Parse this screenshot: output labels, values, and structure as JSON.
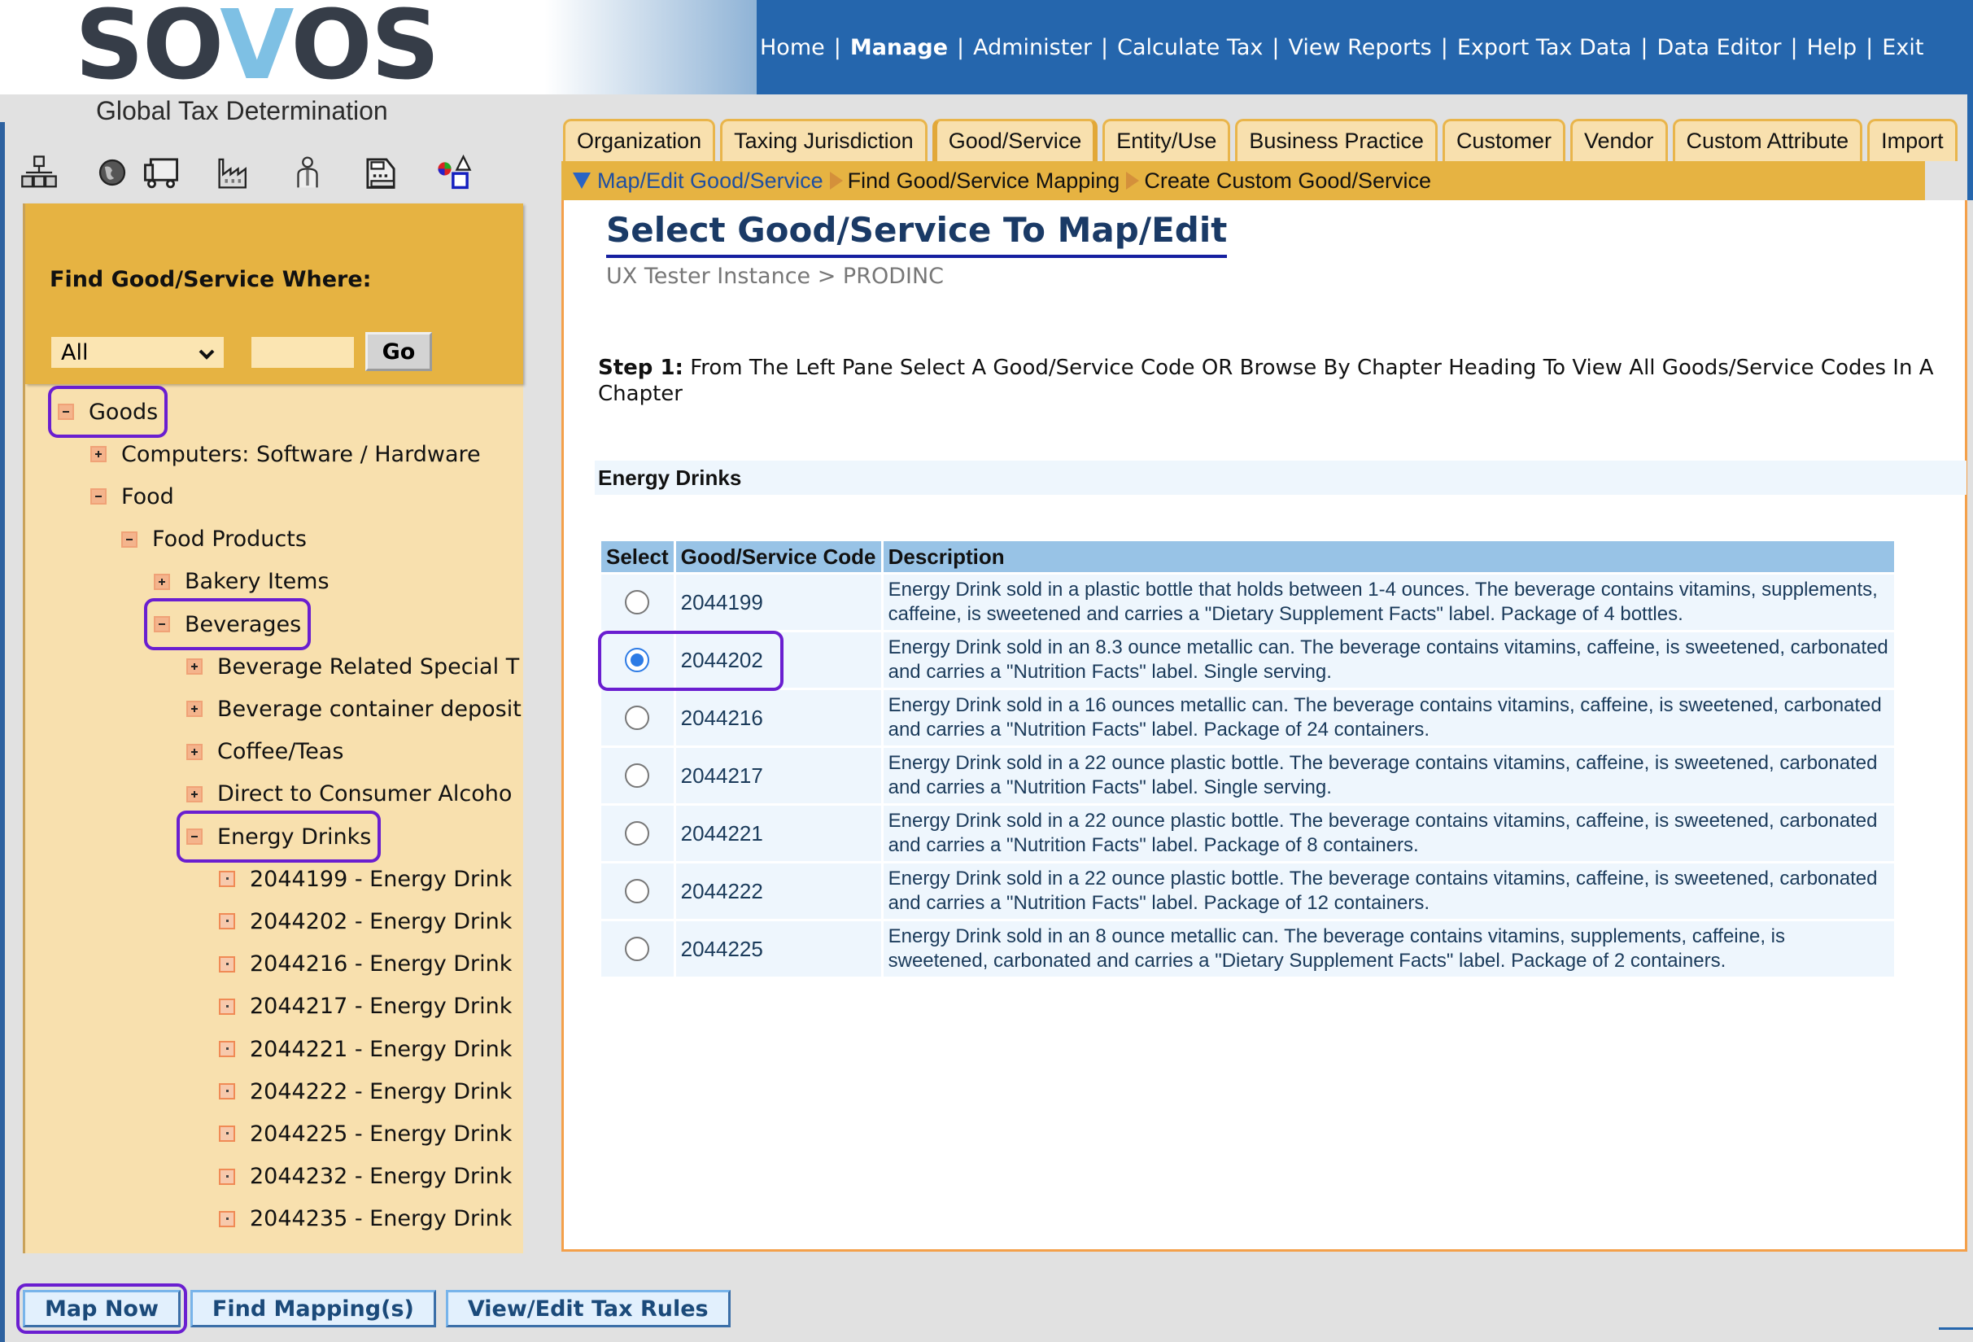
{
  "brand": {
    "logo_prefix": "SO",
    "logo_v": "V",
    "logo_suffix": "OS",
    "subtitle": "Global Tax Determination"
  },
  "top_nav": {
    "items": [
      {
        "label": "Home",
        "active": false
      },
      {
        "label": "Manage",
        "active": true
      },
      {
        "label": "Administer",
        "active": false
      },
      {
        "label": "Calculate Tax",
        "active": false
      },
      {
        "label": "View Reports",
        "active": false
      },
      {
        "label": "Export Tax Data",
        "active": false
      },
      {
        "label": "Data Editor",
        "active": false
      },
      {
        "label": "Help",
        "active": false
      },
      {
        "label": "Exit",
        "active": false
      }
    ],
    "separator": "|"
  },
  "toolbar_icons": [
    "organization-hierarchy-icon",
    "globe-icon",
    "truck-icon",
    "factory-icon",
    "person-icon",
    "cash-register-icon",
    "shapes-icon"
  ],
  "search": {
    "label": "Find Good/Service Where:",
    "select_value": "All",
    "input_value": "",
    "go_label": "Go"
  },
  "tree": {
    "nodes": [
      {
        "label": "Goods",
        "toggle": "minus",
        "level": 0,
        "highlighted": true
      },
      {
        "label": "Computers: Software / Hardware",
        "toggle": "plus",
        "level": 1
      },
      {
        "label": "Food",
        "toggle": "minus",
        "level": 1
      },
      {
        "label": "Food Products",
        "toggle": "minus",
        "level": 2
      },
      {
        "label": "Bakery Items",
        "toggle": "plus",
        "level": 3
      },
      {
        "label": "Beverages",
        "toggle": "minus",
        "level": 3,
        "highlighted": true
      },
      {
        "label": "Beverage Related Special T",
        "toggle": "plus",
        "level": 4
      },
      {
        "label": "Beverage container deposit",
        "toggle": "plus",
        "level": 4
      },
      {
        "label": "Coffee/Teas",
        "toggle": "plus",
        "level": 4
      },
      {
        "label": "Direct to Consumer Alcoho",
        "toggle": "plus",
        "level": 4
      },
      {
        "label": "Energy Drinks",
        "toggle": "minus",
        "level": 4,
        "highlighted": true
      },
      {
        "label": "2044199 - Energy Drink",
        "toggle": "leaf",
        "level": 5
      },
      {
        "label": "2044202 - Energy Drink",
        "toggle": "leaf",
        "level": 5
      },
      {
        "label": "2044216 - Energy Drink",
        "toggle": "leaf",
        "level": 5
      },
      {
        "label": "2044217 - Energy Drink",
        "toggle": "leaf",
        "level": 5
      },
      {
        "label": "2044221 - Energy Drink",
        "toggle": "leaf",
        "level": 5
      },
      {
        "label": "2044222 - Energy Drink",
        "toggle": "leaf",
        "level": 5
      },
      {
        "label": "2044225 - Energy Drink",
        "toggle": "leaf",
        "level": 5
      },
      {
        "label": "2044232 - Energy Drink",
        "toggle": "leaf",
        "level": 5
      },
      {
        "label": "2044235 - Energy Drink",
        "toggle": "leaf",
        "level": 5
      }
    ]
  },
  "tabs": [
    {
      "label": "Organization",
      "active": false
    },
    {
      "label": "Taxing Jurisdiction",
      "active": false
    },
    {
      "label": "Good/Service",
      "active": true
    },
    {
      "label": "Entity/Use",
      "active": false
    },
    {
      "label": "Business Practice",
      "active": false
    },
    {
      "label": "Customer",
      "active": false
    },
    {
      "label": "Vendor",
      "active": false
    },
    {
      "label": "Custom Attribute",
      "active": false
    },
    {
      "label": "Import",
      "active": false
    }
  ],
  "subnav": [
    {
      "label": "Map/Edit Good/Service",
      "active": true
    },
    {
      "label": "Find Good/Service Mapping",
      "active": false
    },
    {
      "label": "Create Custom Good/Service",
      "active": false
    }
  ],
  "main": {
    "title": "Select Good/Service To Map/Edit",
    "breadcrumb": "UX Tester Instance > PRODINC",
    "step_label": "Step 1:",
    "step_text": " From The Left Pane Select A Good/Service Code OR Browse By Chapter Heading To View All Goods/Service Codes In A Chapter",
    "section_title": "Energy Drinks",
    "table": {
      "headers": [
        "Select",
        "Good/Service Code",
        "Description"
      ],
      "rows": [
        {
          "code": "2044199",
          "selected": false,
          "description": "Energy Drink sold in a plastic bottle that holds between 1-4 ounces. The beverage contains vitamins, supplements, caffeine, is sweetened and carries a \"Dietary Supplement Facts\" label. Package of 4 bottles."
        },
        {
          "code": "2044202",
          "selected": true,
          "description": "Energy Drink sold in an 8.3 ounce metallic can. The beverage contains vitamins, caffeine, is sweetened, carbonated and carries a \"Nutrition Facts\" label. Single serving."
        },
        {
          "code": "2044216",
          "selected": false,
          "description": "Energy Drink sold in a 16 ounces metallic can. The beverage contains vitamins, caffeine, is sweetened, carbonated and carries a \"Nutrition Facts\" label. Package of 24 containers."
        },
        {
          "code": "2044217",
          "selected": false,
          "description": "Energy Drink sold in a 22 ounce plastic bottle. The beverage contains vitamins, caffeine, is sweetened, carbonated and carries a \"Nutrition Facts\" label. Single serving."
        },
        {
          "code": "2044221",
          "selected": false,
          "description": "Energy Drink sold in a 22 ounce plastic bottle. The beverage contains vitamins, caffeine, is sweetened, carbonated and carries a \"Nutrition Facts\" label. Package of 8 containers."
        },
        {
          "code": "2044222",
          "selected": false,
          "description": "Energy Drink sold in a 22 ounce plastic bottle. The beverage contains vitamins, caffeine, is sweetened, carbonated and carries a \"Nutrition Facts\" label. Package of 12 containers."
        },
        {
          "code": "2044225",
          "selected": false,
          "description": "Energy Drink sold in an 8 ounce metallic can. The beverage contains vitamins, supplements, caffeine, is sweetened, carbonated and carries a \"Dietary Supplement Facts\" label. Package of 2 containers."
        }
      ]
    }
  },
  "bottom_buttons": [
    {
      "label": "Map Now",
      "highlighted": true
    },
    {
      "label": "Find Mapping(s)",
      "highlighted": false
    },
    {
      "label": "View/Edit Tax Rules",
      "highlighted": false
    }
  ],
  "colors": {
    "nav_blue": "#2566ad",
    "panel_gold": "#e6b342",
    "panel_cream": "#f8e0ae",
    "table_header": "#98c3e6",
    "row_bg": "#eef6fd",
    "title_navy": "#1a3a66",
    "highlight_purple": "#6a1ed0",
    "content_border": "#f4a04a"
  }
}
